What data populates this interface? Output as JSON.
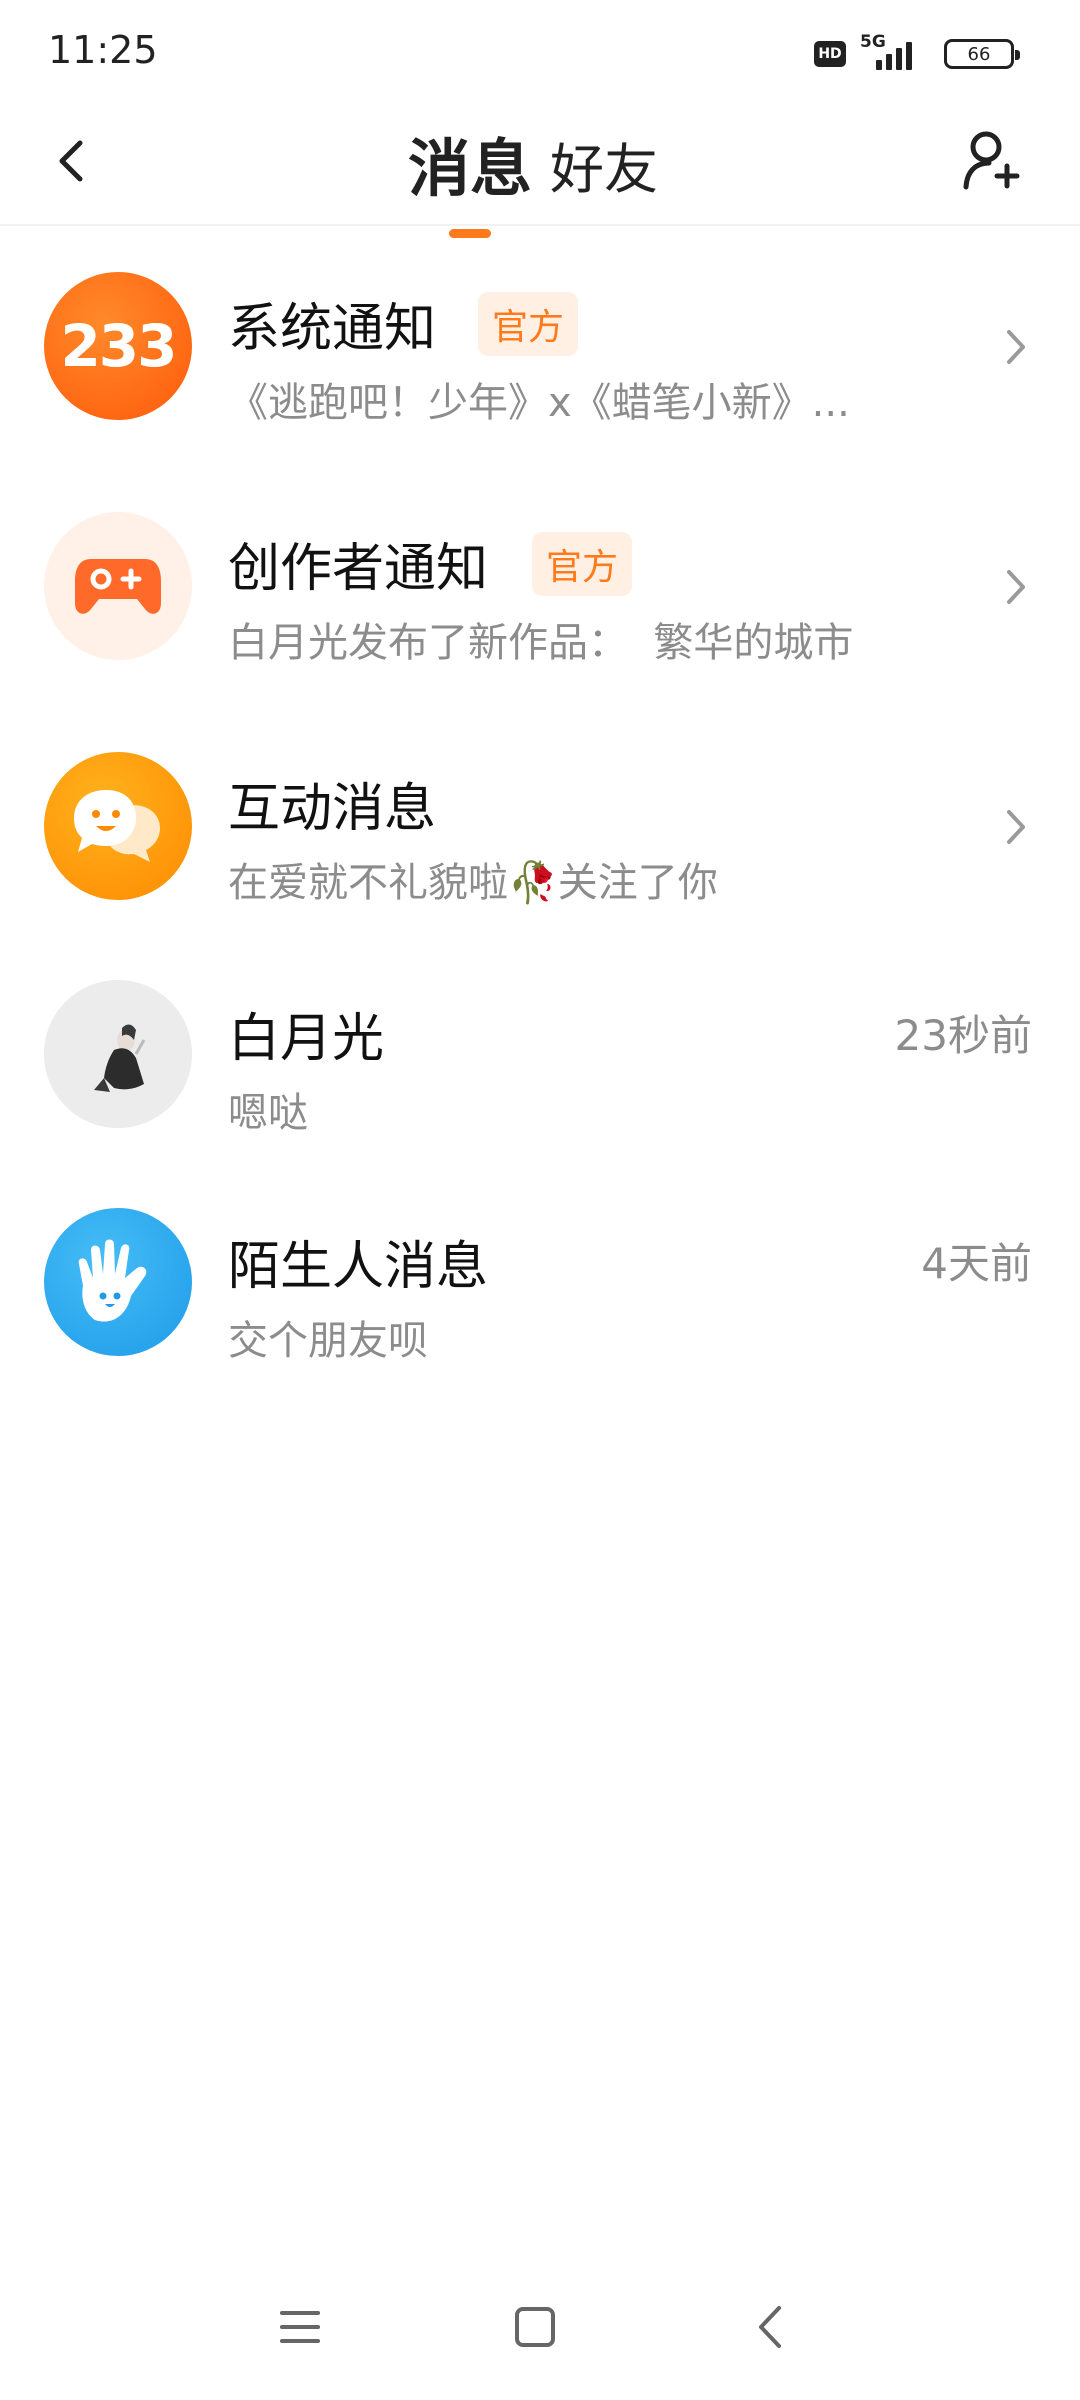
{
  "status_bar": {
    "time": "11:25",
    "hd": "HD",
    "network": "5G",
    "battery": "66"
  },
  "header": {
    "tabs": [
      {
        "label": "消息",
        "active": true
      },
      {
        "label": "好友",
        "active": false
      }
    ],
    "accent_color": "#ff7a1a"
  },
  "messages": [
    {
      "title": "系统通知",
      "badge": "官方",
      "subtitle": "《逃跑吧！少年》x《蜡笔小新》...",
      "avatar_text": "233",
      "avatar_icon": "logo-233-icon",
      "has_chevron": true
    },
    {
      "title": "创作者通知",
      "badge": "官方",
      "subtitle": "白月光发布了新作品：  繁华的城市",
      "avatar_icon": "gamepad-icon",
      "has_chevron": true
    },
    {
      "title": "互动消息",
      "subtitle": "在爱就不礼貌啦🥀关注了你",
      "avatar_icon": "chat-bubble-smile-icon",
      "has_chevron": true
    },
    {
      "title": "白月光",
      "subtitle": "嗯哒",
      "time": "23秒前",
      "avatar_icon": "user-photo-icon"
    },
    {
      "title": "陌生人消息",
      "subtitle": "交个朋友呗",
      "time": "4天前",
      "avatar_icon": "waving-hand-icon"
    }
  ],
  "colors": {
    "orange": "#ff6a13",
    "blue": "#2aa6ee",
    "badge_bg": "#fff0e3"
  }
}
